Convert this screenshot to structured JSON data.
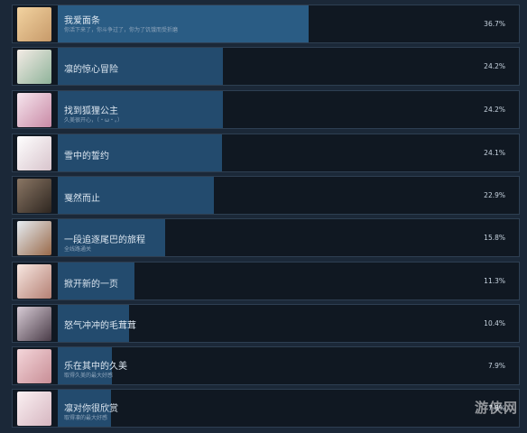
{
  "achievements": [
    {
      "title": "我爱面条",
      "subtitle": "你活下来了，你斗争过了，你为了饥饿而受折磨",
      "percent": "36.7%",
      "value": 36.7,
      "thumb": "#c79a6a"
    },
    {
      "title": "凛的惊心冒险",
      "subtitle": "",
      "percent": "24.2%",
      "value": 24.2,
      "thumb": "#d9c9c0"
    },
    {
      "title": "找到狐狸公主",
      "subtitle": "久美很开心，（・ω・。）",
      "percent": "24.2%",
      "value": 24.2,
      "thumb": "#e6c9d4"
    },
    {
      "title": "雪中的誓约",
      "subtitle": "",
      "percent": "24.1%",
      "value": 24.1,
      "thumb": "#e9dde2"
    },
    {
      "title": "戛然而止",
      "subtitle": "",
      "percent": "22.9%",
      "value": 22.9,
      "thumb": "#5a4a3e"
    },
    {
      "title": "一段追逐尾巴的旅程",
      "subtitle": "全线路通关",
      "percent": "15.8%",
      "value": 15.8,
      "thumb": "#a9b4c0"
    },
    {
      "title": "掀开新的一页",
      "subtitle": "",
      "percent": "11.3%",
      "value": 11.3,
      "thumb": "#ead5cf"
    },
    {
      "title": "怒气冲冲的毛茸茸",
      "subtitle": "",
      "percent": "10.4%",
      "value": 10.4,
      "thumb": "#8d7a86"
    },
    {
      "title": "乐在其中的久美",
      "subtitle": "取得久美的最大好感",
      "percent": "7.9%",
      "value": 7.9,
      "thumb": "#e3c3c8"
    },
    {
      "title": "凛对你很欣赏",
      "subtitle": "取得凛的最大好感",
      "percent": "7.8%",
      "value": 7.8,
      "thumb": "#e8d8dc"
    }
  ],
  "watermark": "游侠网"
}
